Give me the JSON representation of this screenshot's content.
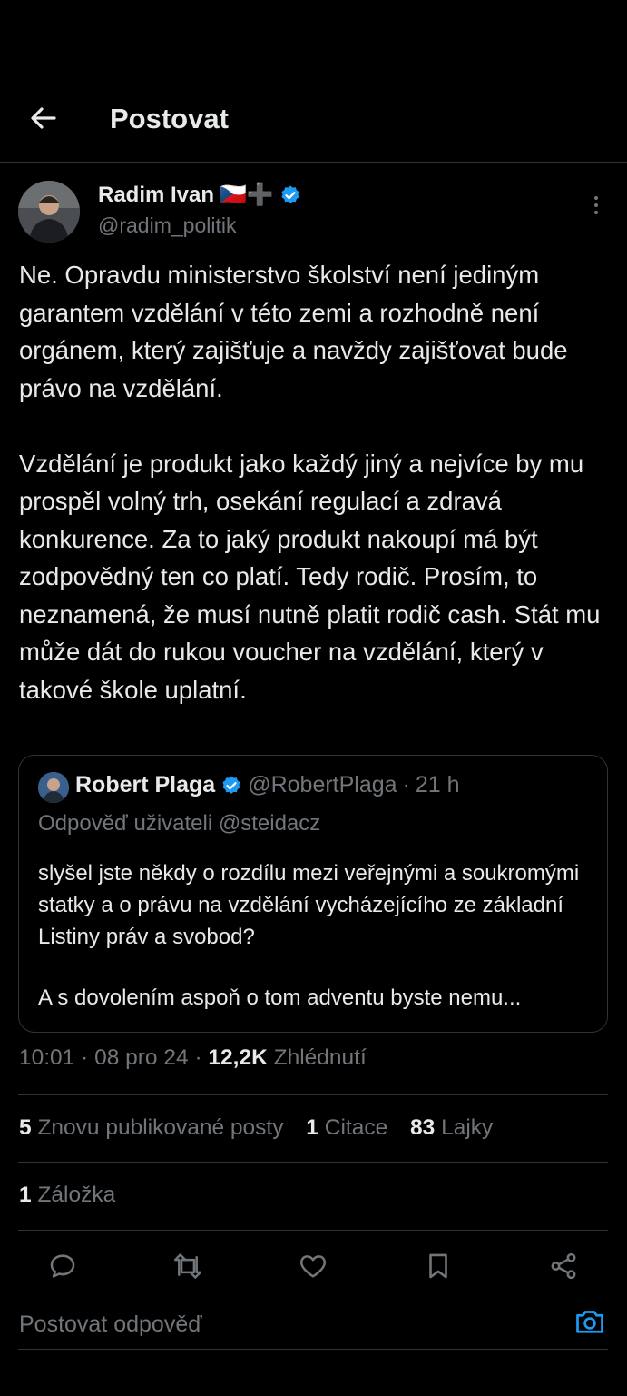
{
  "header": {
    "title": "Postovat"
  },
  "post": {
    "author_name": "Radim Ivan",
    "author_emoji": "🇨🇿➕",
    "handle": "@radim_politik",
    "text": "Ne. Opravdu ministerstvo školství není jediným garantem vzdělání v této zemi a rozhodně není orgánem, který zajišťuje a navždy zajišťovat bude právo na vzdělání.\n\nVzdělání je produkt jako každý jiný a nejvíce by mu prospěl volný trh, osekání regulací a zdravá konkurence. Za to jaký produkt nakoupí má být zodpovědný ten co platí. Tedy rodič. Prosím, to neznamená, že musí nutně platit rodič cash. Stát mu může dát do rukou voucher na vzdělání, který v takové škole uplatní.",
    "time": "10:01",
    "date": "08 pro 24",
    "views": "12,2K",
    "views_label": "Zhlédnutí",
    "reposts": "5",
    "reposts_label": "Znovu publikované posty",
    "quotes": "1",
    "quotes_label": "Citace",
    "likes": "83",
    "likes_label": "Lajky",
    "bookmarks": "1",
    "bookmarks_label": "Záložka"
  },
  "quote": {
    "author_name": "Robert Plaga",
    "handle": "@RobertPlaga",
    "time": "21 h",
    "reply_to": "Odpověď uživateli @steidacz",
    "text": "slyšel jste někdy o rozdílu mezi veřejnými a soukromými statky a o právu na vzdělání vycházejícího ze základní Listiny práv a svobod?",
    "text_truncated": "A s dovolením aspoň o tom adventu byste nemu..."
  },
  "reply": {
    "placeholder": "Postovat odpověď"
  },
  "colors": {
    "accent": "#1d9bf0",
    "text": "#e7e9ea",
    "secondary": "#71767b",
    "border": "#2f3336",
    "background": "#000000"
  },
  "icons": {
    "back": "arrow-left-icon",
    "more": "more-vertical-icon",
    "verified": "verified-badge-icon",
    "reply": "reply-icon",
    "repost": "repost-icon",
    "like": "heart-icon",
    "bookmark": "bookmark-icon",
    "share": "share-icon",
    "camera": "camera-icon"
  }
}
